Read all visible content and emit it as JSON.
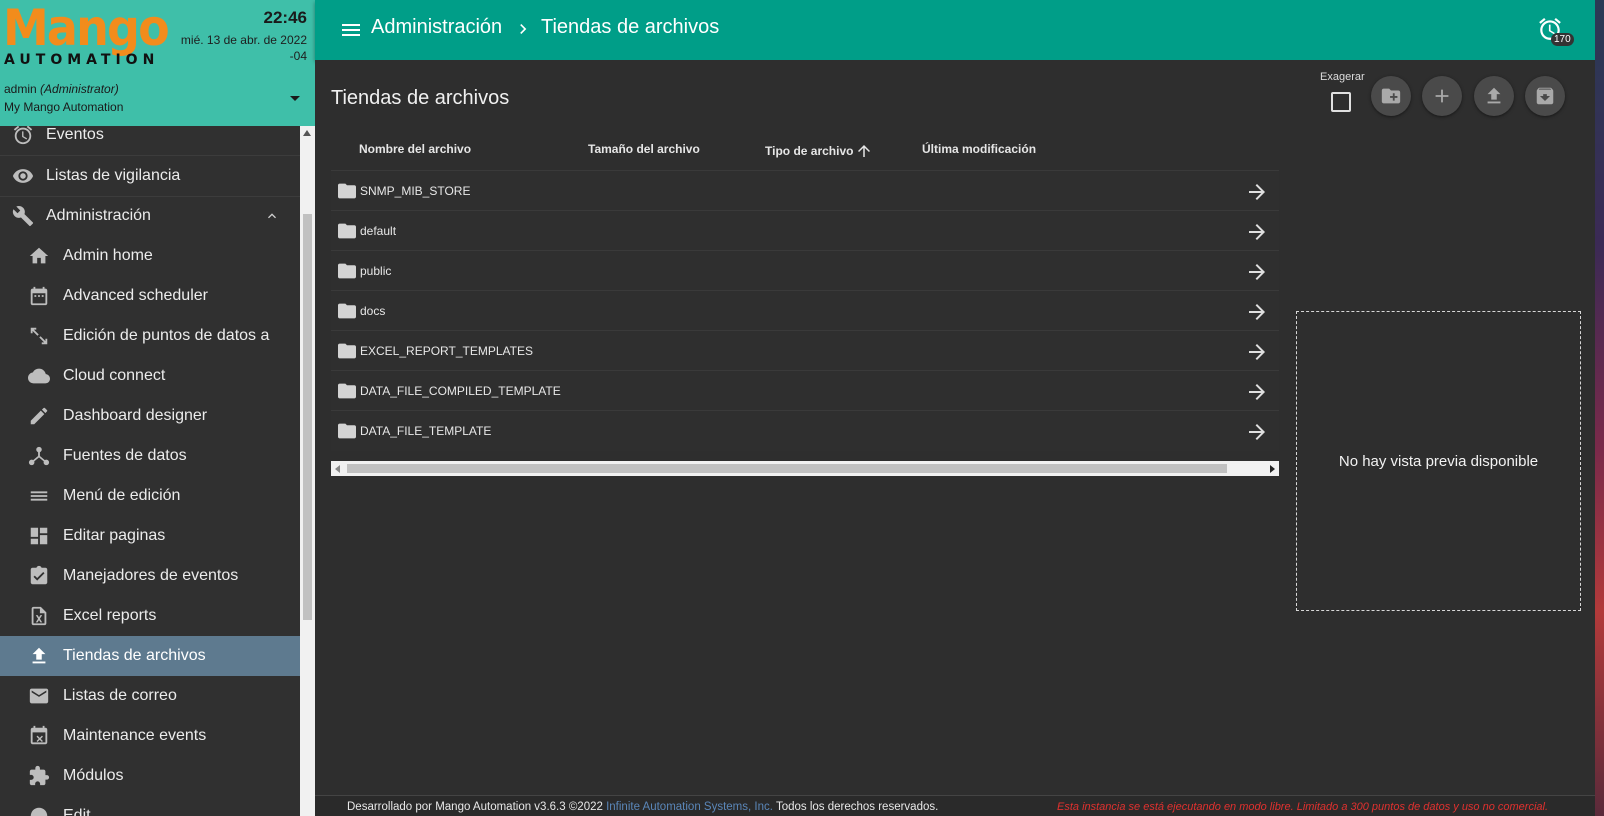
{
  "header": {
    "logo_top": "Mango",
    "logo_bottom": "AUTOMATION",
    "time": "22:46",
    "date": "mié. 13 de abr. de 2022",
    "tz": "-04",
    "user_name": "admin",
    "user_role": "(Administrator)",
    "org": "My Mango Automation"
  },
  "menu": {
    "top_items": [
      {
        "label": "Eventos",
        "icon": "alarm-clock-icon"
      },
      {
        "label": "Listas de vigilancia",
        "icon": "eye-icon"
      },
      {
        "label": "Administración",
        "icon": "wrench-icon"
      }
    ],
    "sub_items": [
      {
        "label": "Admin home",
        "icon": "home-icon"
      },
      {
        "label": "Advanced scheduler",
        "icon": "calendar-icon"
      },
      {
        "label": "Edición de puntos de datos a",
        "icon": "resize-icon"
      },
      {
        "label": "Cloud connect",
        "icon": "cloud-icon"
      },
      {
        "label": "Dashboard designer",
        "icon": "pencil-icon"
      },
      {
        "label": "Fuentes de datos",
        "icon": "hub-icon"
      },
      {
        "label": "Menú de edición",
        "icon": "list-icon"
      },
      {
        "label": "Editar paginas",
        "icon": "dashboard-icon"
      },
      {
        "label": "Manejadores de eventos",
        "icon": "clipboard-check-icon"
      },
      {
        "label": "Excel reports",
        "icon": "excel-icon"
      },
      {
        "label": "Tiendas de archivos",
        "icon": "upload-icon"
      },
      {
        "label": "Listas de correo",
        "icon": "mail-icon"
      },
      {
        "label": "Maintenance events",
        "icon": "calendar-x-icon"
      },
      {
        "label": "Módulos",
        "icon": "puzzle-icon"
      },
      {
        "label": "Edit...",
        "icon": "globe-icon"
      }
    ],
    "active": "Tiendas de archivos",
    "accent": "#5e7a8f"
  },
  "topbar": {
    "crumb1": "Administración",
    "crumb2": "Tiendas de archivos",
    "alarm_count": "170",
    "color": "#009e88"
  },
  "main": {
    "title": "Tiendas de archivos",
    "exaggerate_label": "Exagerar",
    "columns": {
      "name": "Nombre del archivo",
      "size": "Tamaño del archivo",
      "type": "Tipo de archivo",
      "modified": "Última modificación"
    },
    "rows": [
      "SNMP_MIB_STORE",
      "default",
      "public",
      "docs",
      "EXCEL_REPORT_TEMPLATES",
      "DATA_FILE_COMPILED_TEMPLATE",
      "DATA_FILE_TEMPLATE"
    ],
    "preview_text": "No hay vista previa disponible"
  },
  "footer": {
    "prefix": "Desarrollado por Mango Automation v3.6.3 ©2022",
    "link": "Infinite Automation Systems, Inc.",
    "suffix": "Todos los derechos reservados.",
    "warning": "Esta instancia se está ejecutando en modo libre. Limitado a 300 puntos de datos y uso no comercial."
  }
}
